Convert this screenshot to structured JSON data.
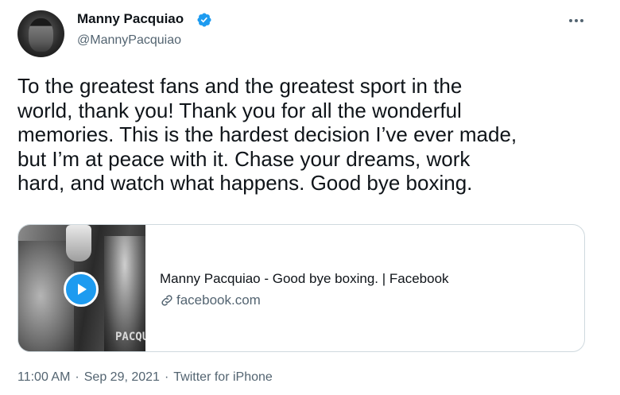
{
  "author": {
    "display_name": "Manny Pacquiao",
    "handle": "@MannyPacquiao",
    "verified": true
  },
  "tweet": {
    "text": "To the greatest fans and the greatest sport in the\nworld, thank you! Thank you for all the wonderful\nmemories. This is the hardest decision I’ve ever made,\nbut I’m at peace with it. Chase your dreams, work\nhard, and watch what happens. Good bye boxing."
  },
  "card": {
    "title": "Manny Pacquiao - Good bye boxing. | Facebook",
    "domain": "facebook.com",
    "thumbnail_text": "PACQU",
    "media_icon": "play-icon"
  },
  "meta": {
    "time": "11:00 AM",
    "date": "Sep 29, 2021",
    "source": "Twitter for iPhone",
    "separator": "·"
  },
  "icons": {
    "verified": "verified-badge-icon",
    "more": "more-options-icon",
    "link": "link-icon"
  },
  "colors": {
    "accent": "#1d9bf0",
    "text_primary": "#0f1419",
    "text_secondary": "#536471",
    "border": "#cfd9de"
  }
}
